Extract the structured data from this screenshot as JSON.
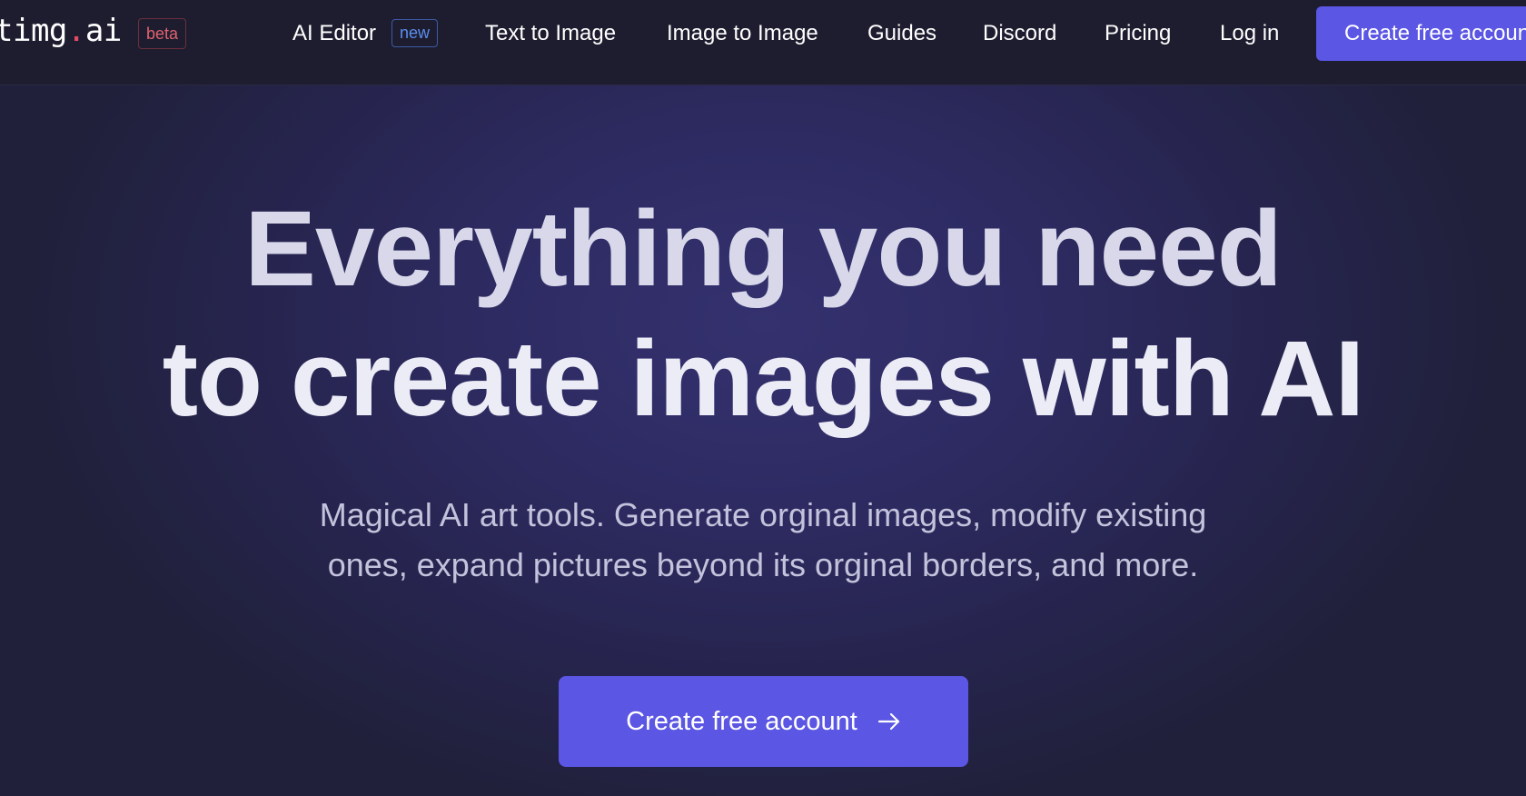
{
  "nav": {
    "logo_main": "timg",
    "logo_dot": ".",
    "logo_tld": "ai",
    "beta_badge": "beta",
    "links": [
      {
        "label": "AI Editor"
      },
      {
        "label": "Text to Image"
      },
      {
        "label": "Image to Image"
      },
      {
        "label": "Guides"
      },
      {
        "label": "Discord"
      },
      {
        "label": "Pricing"
      },
      {
        "label": "Log in"
      }
    ],
    "new_badge": "new",
    "cta_label": "Create free account"
  },
  "hero": {
    "headline_line1": "Everything you need",
    "headline_line2": "to create images with AI",
    "subtitle_line1": "Magical AI art tools. Generate orginal images, modify existing",
    "subtitle_line2": "ones, expand pictures beyond its orginal borders, and more.",
    "cta_label": "Create free account",
    "cta_icon": "arrow-right-icon"
  },
  "colors": {
    "nav_background": "#1e1d2f",
    "hero_background": "#2e2b63",
    "accent": "#5b56e3",
    "beta_red": "#e0616f",
    "new_blue": "#5b8def"
  }
}
